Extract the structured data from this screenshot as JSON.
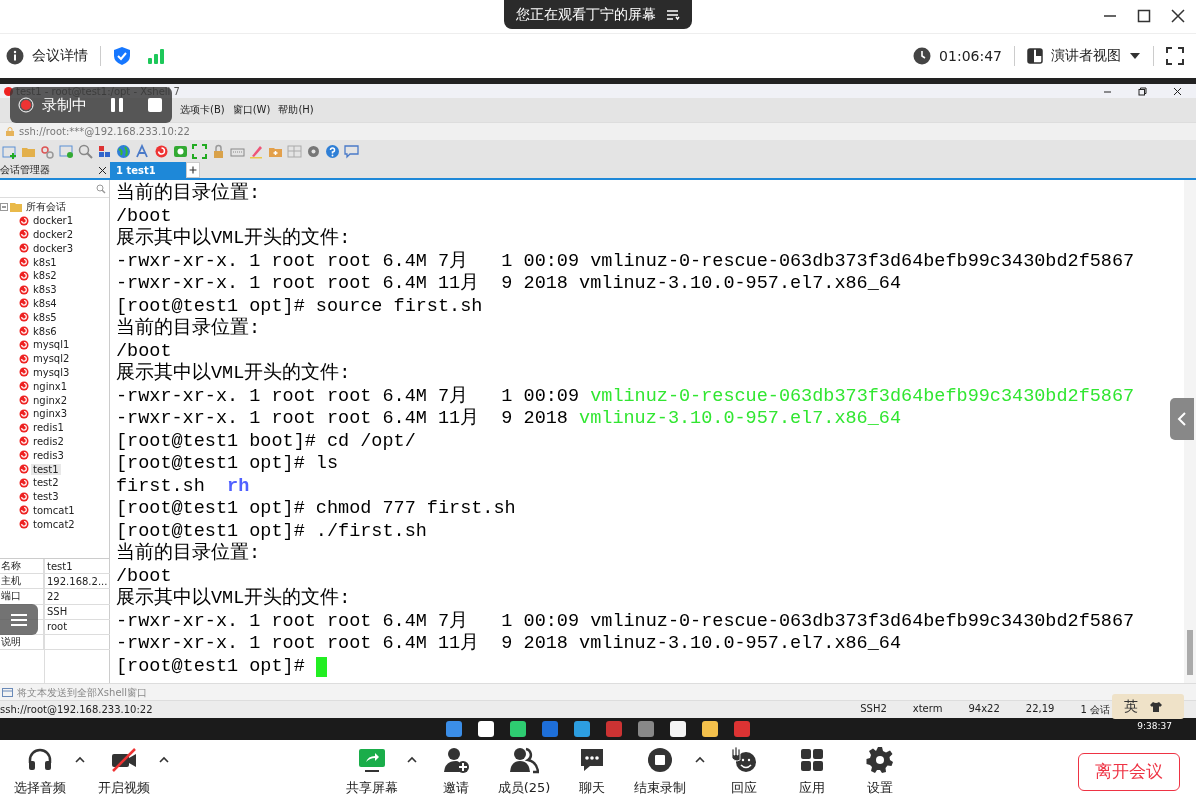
{
  "meeting": {
    "banner": "您正在观看丁宁的屏幕",
    "info": "会议详情",
    "timer": "01:06:47",
    "view": "演讲者视图"
  },
  "recording": {
    "label": "录制中"
  },
  "xshell": {
    "title": "test1 - root@test1:/opt - Xshell 7",
    "menu": [
      "选项卡(B)",
      "窗口(W)",
      "帮助(H)"
    ],
    "address": "ssh://root:***@192.168.233.10:22",
    "session_panel": {
      "title": "会话管理器",
      "tree": [
        {
          "label": "所有会话",
          "expanded": true,
          "children": [
            {
              "label": "docker1",
              "selected": false
            },
            {
              "label": "docker2",
              "selected": false
            },
            {
              "label": "docker3",
              "selected": false
            },
            {
              "label": "k8s1",
              "selected": false
            },
            {
              "label": "k8s2",
              "selected": false
            },
            {
              "label": "k8s3",
              "selected": false
            },
            {
              "label": "k8s4",
              "selected": false
            },
            {
              "label": "k8s5",
              "selected": false
            },
            {
              "label": "k8s6",
              "selected": false
            },
            {
              "label": "mysql1",
              "selected": false
            },
            {
              "label": "mysql2",
              "selected": false
            },
            {
              "label": "mysql3",
              "selected": false
            },
            {
              "label": "nginx1",
              "selected": false
            },
            {
              "label": "nginx2",
              "selected": false
            },
            {
              "label": "nginx3",
              "selected": false
            },
            {
              "label": "redis1",
              "selected": false
            },
            {
              "label": "redis2",
              "selected": false
            },
            {
              "label": "redis3",
              "selected": false
            },
            {
              "label": "test1",
              "selected": true
            },
            {
              "label": "test2",
              "selected": false
            },
            {
              "label": "test3",
              "selected": false
            },
            {
              "label": "tomcat1",
              "selected": false
            },
            {
              "label": "tomcat2",
              "selected": false
            }
          ]
        }
      ],
      "properties": [
        {
          "name": "名称",
          "value": "test1"
        },
        {
          "name": "主机",
          "value": "192.168.2..."
        },
        {
          "name": "端口",
          "value": "22"
        },
        {
          "value": "SSH"
        },
        {
          "value": "root"
        },
        {
          "name": "说明"
        }
      ]
    },
    "tabs": [
      {
        "label": "1 test1",
        "selected": true
      }
    ],
    "terminal": {
      "lines": [
        {
          "segments": [
            {
              "text": "当前的目录位置:",
              "kind": "plain"
            }
          ]
        },
        {
          "segments": [
            {
              "text": "/boot",
              "kind": "plain"
            }
          ]
        },
        {
          "segments": [
            {
              "text": "展示其中以VML开头的文件:",
              "kind": "plain"
            }
          ]
        },
        {
          "segments": [
            {
              "text": "-rwxr-xr-x. 1 root root 6.4M 7月   1 00:09 vmlinuz-0-rescue-063db373f3d64befb99c3430bd2f5867",
              "kind": "plain"
            }
          ]
        },
        {
          "segments": [
            {
              "text": "-rwxr-xr-x. 1 root root 6.4M 11月  9 2018 vmlinuz-3.10.0-957.el7.x86_64",
              "kind": "plain"
            }
          ]
        },
        {
          "segments": [
            {
              "text": "[root@test1 opt]# source first.sh",
              "kind": "plain"
            }
          ]
        },
        {
          "segments": [
            {
              "text": "当前的目录位置:",
              "kind": "plain"
            }
          ]
        },
        {
          "segments": [
            {
              "text": "/boot",
              "kind": "plain"
            }
          ]
        },
        {
          "segments": [
            {
              "text": "展示其中以VML开头的文件:",
              "kind": "plain"
            }
          ]
        },
        {
          "segments": [
            {
              "text": "-rwxr-xr-x. 1 root root 6.4M 7月   1 00:09 ",
              "kind": "plain"
            },
            {
              "text": "vmlinuz-0-rescue-063db373f3d64befb99c3430bd2f5867",
              "kind": "executable"
            }
          ]
        },
        {
          "segments": [
            {
              "text": "-rwxr-xr-x. 1 root root 6.4M 11月  9 2018 ",
              "kind": "plain"
            },
            {
              "text": "vmlinuz-3.10.0-957.el7.x86_64",
              "kind": "executable"
            }
          ]
        },
        {
          "segments": [
            {
              "text": "[root@test1 boot]# cd /opt/",
              "kind": "plain"
            }
          ]
        },
        {
          "segments": [
            {
              "text": "[root@test1 opt]# ls",
              "kind": "plain"
            }
          ]
        },
        {
          "segments": [
            {
              "text": "first.sh  ",
              "kind": "plain"
            },
            {
              "text": "rh",
              "kind": "directory"
            }
          ]
        },
        {
          "segments": [
            {
              "text": "[root@test1 opt]# chmod 777 first.sh",
              "kind": "plain"
            }
          ]
        },
        {
          "segments": [
            {
              "text": "[root@test1 opt]# ./first.sh",
              "kind": "plain"
            }
          ]
        },
        {
          "segments": [
            {
              "text": "当前的目录位置:",
              "kind": "plain"
            }
          ]
        },
        {
          "segments": [
            {
              "text": "/boot",
              "kind": "plain"
            }
          ]
        },
        {
          "segments": [
            {
              "text": "展示其中以VML开头的文件:",
              "kind": "plain"
            }
          ]
        },
        {
          "segments": [
            {
              "text": "-rwxr-xr-x. 1 root root 6.4M 7月   1 00:09 vmlinuz-0-rescue-063db373f3d64befb99c3430bd2f5867",
              "kind": "plain"
            }
          ]
        },
        {
          "segments": [
            {
              "text": "-rwxr-xr-x. 1 root root 6.4M 11月  9 2018 vmlinuz-3.10.0-957.el7.x86_64",
              "kind": "plain"
            }
          ]
        },
        {
          "segments": [
            {
              "text": "[root@test1 opt]# ",
              "kind": "plain"
            }
          ],
          "cursor": true
        }
      ]
    },
    "compose_placeholder": "将文本发送到全部Xshell窗口",
    "status": {
      "address": "ssh://root@192.168.233.10:22",
      "items": [
        "SSH2",
        "xterm",
        "94x22",
        "22,19",
        "1 会话"
      ]
    },
    "ime": "英"
  },
  "taskbar": {
    "time": "9:38:37"
  },
  "toolbar": [
    {
      "label": "选择音频",
      "kind": "headset",
      "has_menu": true
    },
    {
      "label": "开启视频",
      "kind": "camera-off",
      "has_menu": true
    },
    {
      "label": "共享屏幕",
      "kind": "share",
      "has_menu": true
    },
    {
      "label": "邀请",
      "kind": "invite",
      "has_menu": false
    },
    {
      "label": "成员(25)",
      "kind": "members",
      "has_menu": false
    },
    {
      "label": "聊天",
      "kind": "chat",
      "has_menu": false
    },
    {
      "label": "结束录制",
      "kind": "stop-record",
      "has_menu": true
    },
    {
      "label": "回应",
      "kind": "reaction",
      "has_menu": false
    },
    {
      "label": "应用",
      "kind": "apps",
      "has_menu": false
    },
    {
      "label": "设置",
      "kind": "settings",
      "has_menu": false
    }
  ],
  "leave_button": "离开会议"
}
